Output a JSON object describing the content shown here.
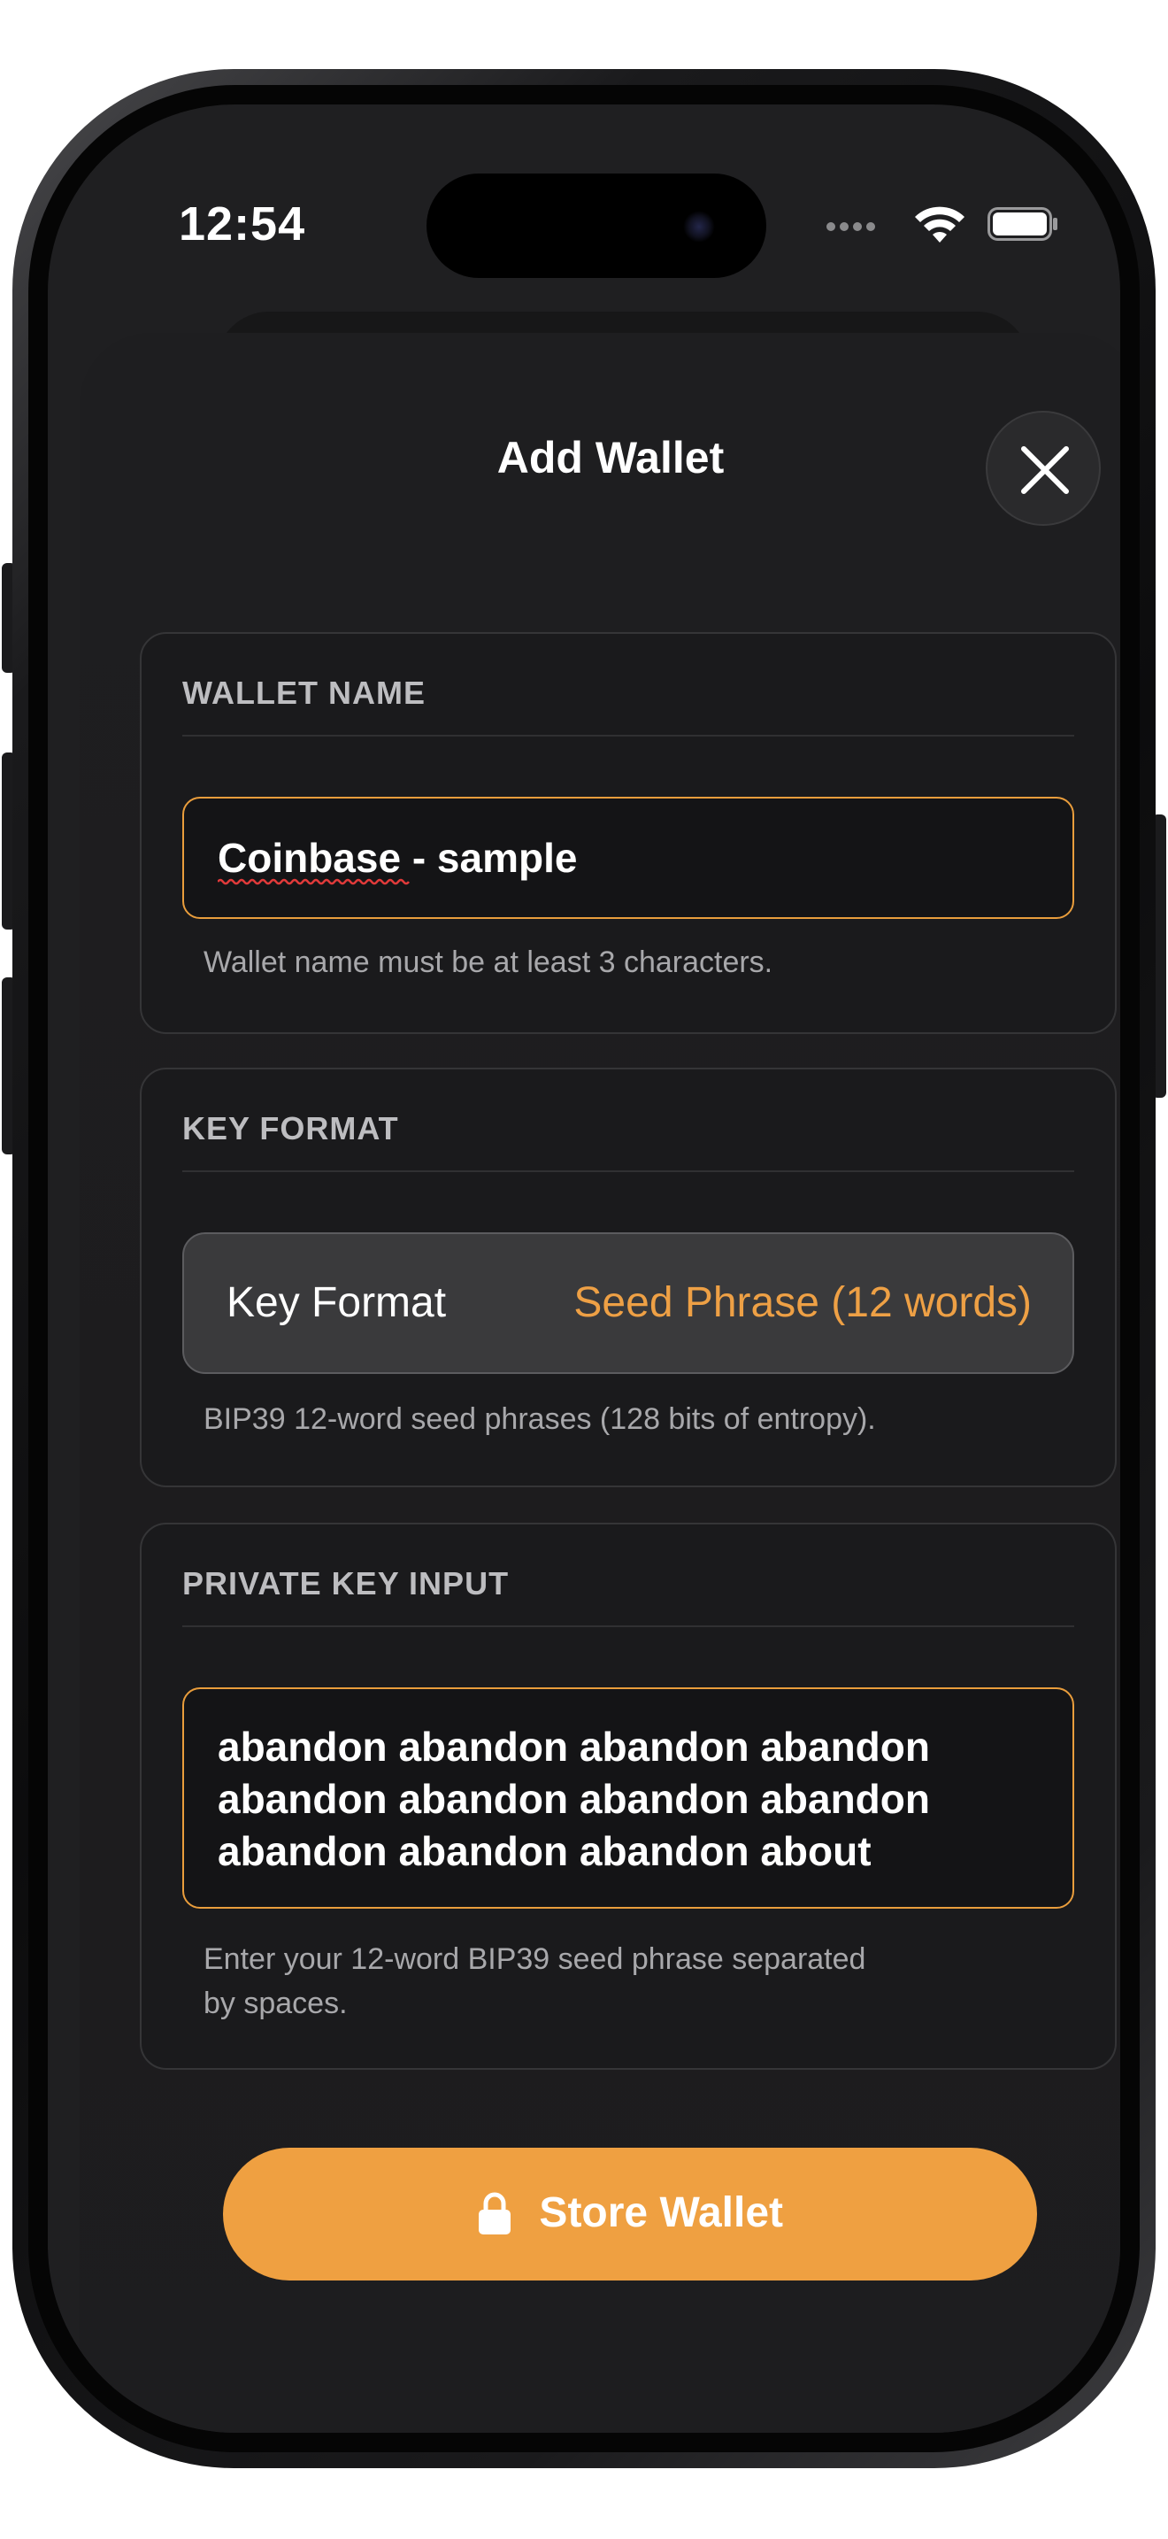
{
  "status_bar": {
    "time": "12:54"
  },
  "sheet": {
    "title": "Add Wallet"
  },
  "wallet_name": {
    "section_label": "WALLET NAME",
    "value": "Coinbase - sample",
    "helper": "Wallet name must be at least 3 characters."
  },
  "key_format": {
    "section_label": "KEY FORMAT",
    "row_label": "Key Format",
    "selected_value": "Seed Phrase (12 words)",
    "helper": "BIP39 12-word seed phrases (128 bits of entropy)."
  },
  "private_key": {
    "section_label": "PRIVATE KEY INPUT",
    "lines": [
      "abandon abandon abandon abandon",
      "abandon abandon abandon abandon",
      "abandon abandon abandon about"
    ],
    "helper_lines": [
      "Enter your 12-word BIP39 seed phrase separated",
      "by spaces."
    ]
  },
  "store_button": {
    "label": "Store Wallet",
    "icon": "lock-icon"
  },
  "colors": {
    "accent": "#EFA041",
    "background": "#1F1F21",
    "card": "#1A1A1C"
  }
}
